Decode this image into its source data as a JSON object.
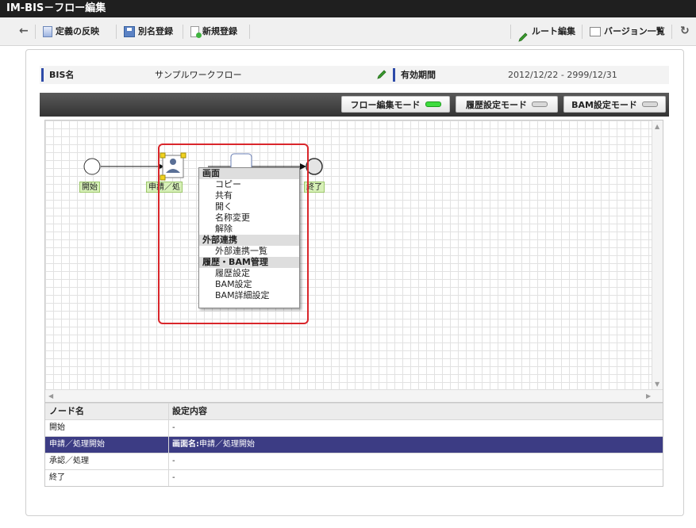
{
  "window": {
    "title": "IM-BIS－フロー編集"
  },
  "toolbar": {
    "back_icon": "arrow-left-icon",
    "reflect_label": "定義の反映",
    "alias_label": "別名登録",
    "new_label": "新規登録",
    "route_edit_label": "ルート編集",
    "version_list_label": "バージョン一覧",
    "refresh_icon": "refresh-icon"
  },
  "info": {
    "bis_name_label": "BIS名",
    "bis_name_value": "サンプルワークフロー",
    "validity_label": "有効期間",
    "validity_value": "2012/12/22 - 2999/12/31"
  },
  "modes": [
    {
      "label": "フロー編集モード",
      "active": true
    },
    {
      "label": "履歴設定モード",
      "active": false
    },
    {
      "label": "BAM設定モード",
      "active": false
    }
  ],
  "flow": {
    "nodes": [
      {
        "label": "開始",
        "kind": "start"
      },
      {
        "label": "申請／処",
        "kind": "user-task"
      },
      {
        "label": "",
        "kind": "task"
      },
      {
        "label": "終了",
        "kind": "end"
      }
    ]
  },
  "context_menu": {
    "sections": [
      {
        "header": "画面",
        "items": [
          "コピー",
          "共有",
          "開く",
          "名称変更",
          "解除"
        ]
      },
      {
        "header": "外部連携",
        "items": [
          "外部連携一覧"
        ]
      },
      {
        "header": "履歴・BAM管理",
        "items": [
          "履歴設定",
          "BAM設定",
          "BAM詳細設定"
        ]
      }
    ]
  },
  "table": {
    "headers": [
      "ノード名",
      "設定内容"
    ],
    "rows": [
      {
        "name": "開始",
        "value": "-",
        "selected": false
      },
      {
        "name": "申請／処理開始",
        "value_bold": "画面名:",
        "value": "申請／処理開始",
        "selected": true
      },
      {
        "name": "承認／処理",
        "value": "-",
        "selected": false
      },
      {
        "name": "終了",
        "value": "-",
        "selected": false
      }
    ]
  },
  "colors": {
    "title_bg": "#1f1f1f",
    "selected_row": "#3c3c84",
    "highlight_frame": "#d9262b",
    "led_on": "#3edc3e",
    "node_label_bg": "#d7f0b8"
  }
}
